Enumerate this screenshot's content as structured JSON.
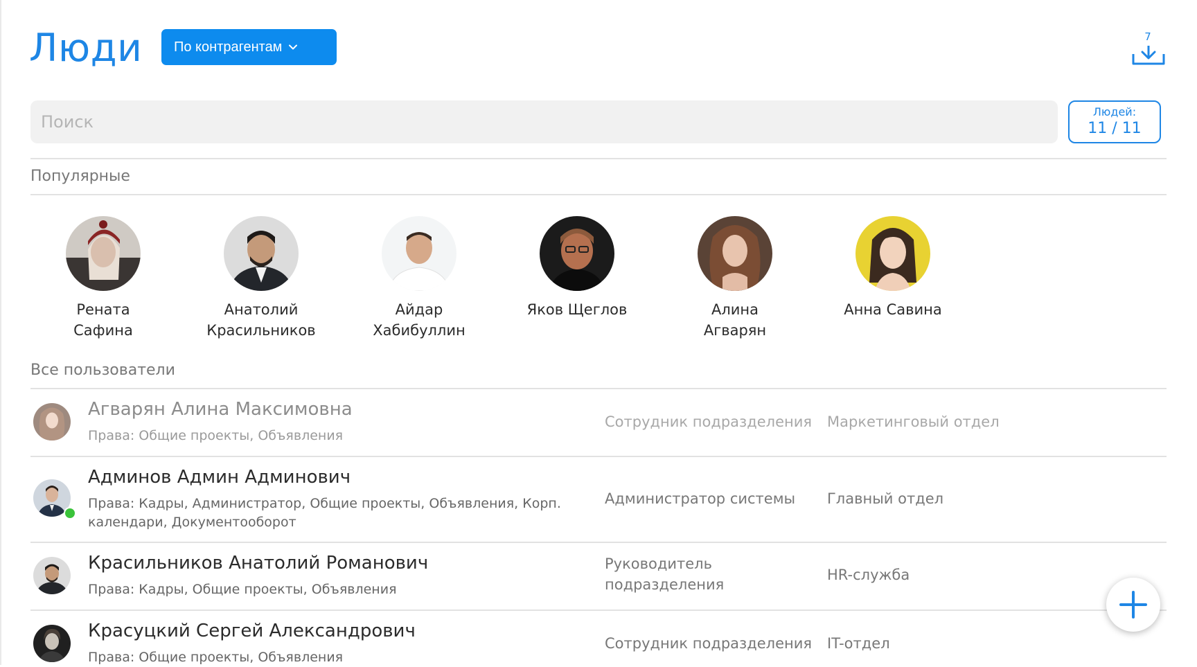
{
  "header": {
    "title": "Люди",
    "filter_label": "По контрагентам",
    "download_count": "7"
  },
  "search": {
    "placeholder": "Поиск",
    "value": ""
  },
  "counter": {
    "label": "Людей:",
    "value": "11 / 11"
  },
  "sections": {
    "popular_title": "Популярные",
    "all_title": "Все пользователи"
  },
  "popular": [
    {
      "first": "Рената",
      "last": "Сафина"
    },
    {
      "first": "Анатолий",
      "last": "Красильников"
    },
    {
      "first": "Айдар",
      "last": "Хабибуллин"
    },
    {
      "first": "Яков Щеглов",
      "last": ""
    },
    {
      "first": "Алина",
      "last": "Агварян"
    },
    {
      "first": "Анна Савина",
      "last": ""
    }
  ],
  "users": [
    {
      "name": "Агварян Алина Максимовна",
      "rights": "Права: Общие проекты, Объявления",
      "role": "Сотрудник подразделения",
      "dept": "Маркетинговый отдел"
    },
    {
      "name": "Админов Админ Админович",
      "rights": "Права: Кадры, Администратор, Общие проекты, Объявления, Корп. календари, Документооборот",
      "role": "Администратор системы",
      "dept": "Главный отдел"
    },
    {
      "name": "Красильников Анатолий Романович",
      "rights": "Права: Кадры, Общие проекты, Объявления",
      "role": "Руководитель подразделения",
      "dept": "HR-служба"
    },
    {
      "name": "Красуцкий Сергей Александрович",
      "rights": "Права: Общие проекты, Объявления",
      "role": "Сотрудник подразделения",
      "dept": "IT-отдел"
    }
  ],
  "colors": {
    "accent": "#1e86e5",
    "button": "#0d8bee",
    "online": "#3ac33a"
  },
  "icons": {
    "download": "download-tray-icon",
    "chevron": "chevron-down-icon",
    "add": "plus-icon"
  }
}
